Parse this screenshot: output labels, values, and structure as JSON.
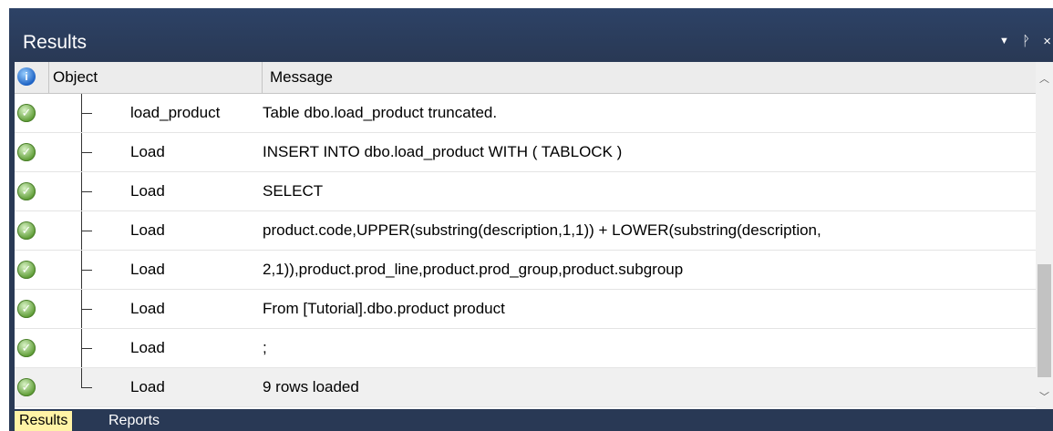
{
  "panel": {
    "title": "Results",
    "controls": [
      "▼",
      "ᚹ",
      "×"
    ]
  },
  "header": {
    "object": "Object",
    "message": "Message"
  },
  "rows": [
    {
      "object": "load_product",
      "message": "Table dbo.load_product truncated."
    },
    {
      "object": "Load",
      "message": "INSERT INTO dbo.load_product  WITH ( TABLOCK )"
    },
    {
      "object": "Load",
      "message": "SELECT"
    },
    {
      "object": "Load",
      "message": "product.code,UPPER(substring(description,1,1)) + LOWER(substring(description,"
    },
    {
      "object": "Load",
      "message": "2,1)),product.prod_line,product.prod_group,product.subgroup"
    },
    {
      "object": "Load",
      "message": "From [Tutorial].dbo.product product"
    },
    {
      "object": "Load",
      "message": ";"
    },
    {
      "object": "Load",
      "message": "9 rows loaded"
    }
  ],
  "tabs": [
    "Results",
    "Reports"
  ]
}
